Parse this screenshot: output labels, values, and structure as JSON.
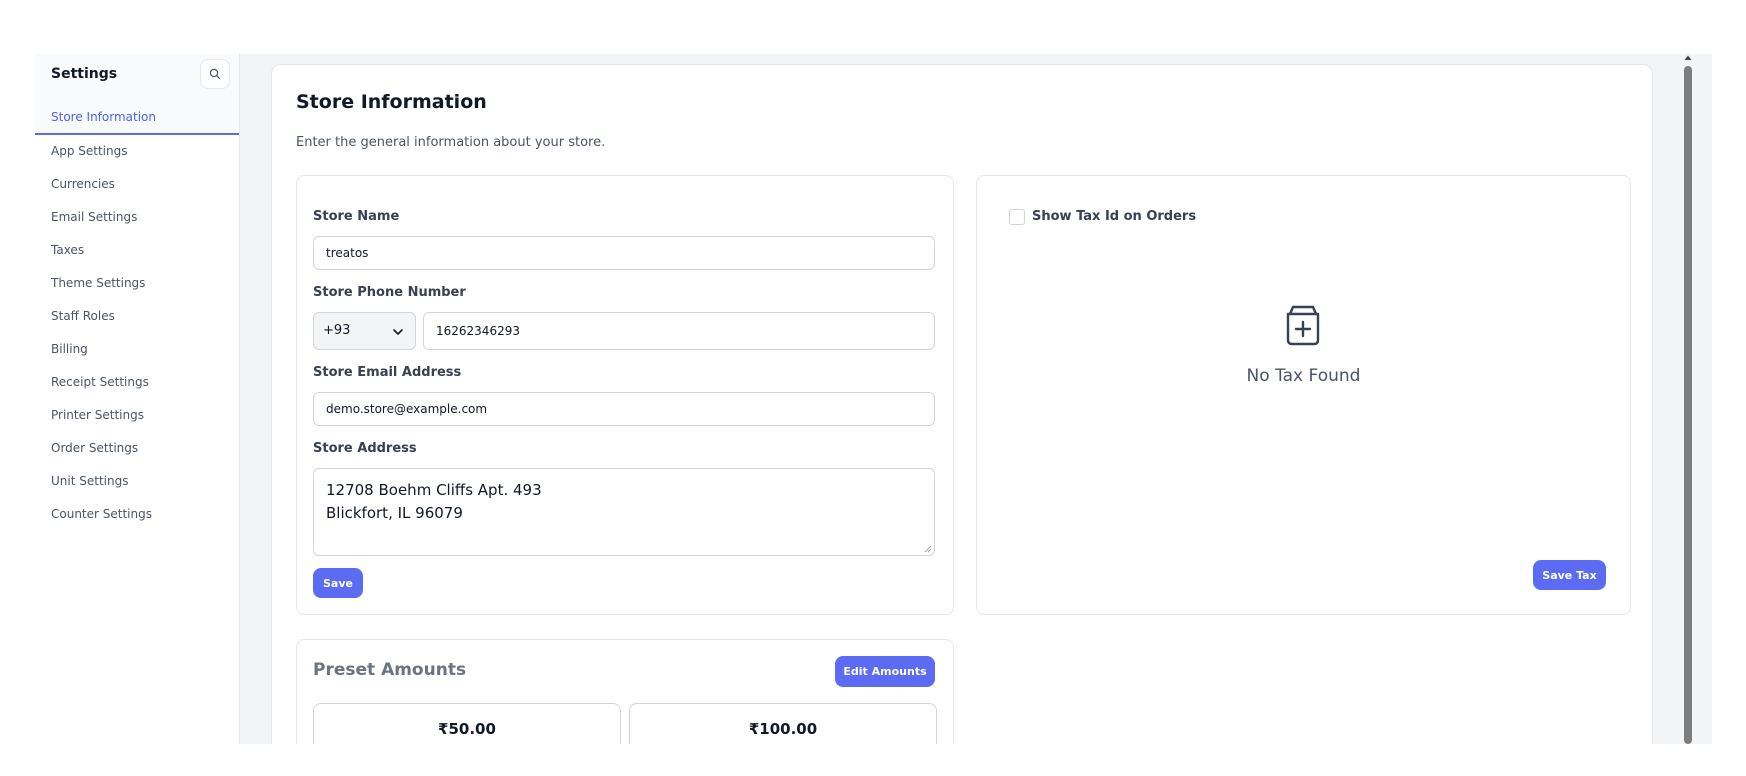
{
  "sidebar": {
    "title": "Settings",
    "search_icon": "search-icon",
    "items": [
      {
        "label": "Store Information",
        "active": true
      },
      {
        "label": "App Settings"
      },
      {
        "label": "Currencies"
      },
      {
        "label": "Email Settings"
      },
      {
        "label": "Taxes"
      },
      {
        "label": "Theme Settings"
      },
      {
        "label": "Staff Roles"
      },
      {
        "label": "Billing"
      },
      {
        "label": "Receipt Settings"
      },
      {
        "label": "Printer Settings"
      },
      {
        "label": "Order Settings"
      },
      {
        "label": "Unit Settings"
      },
      {
        "label": "Counter Settings"
      }
    ]
  },
  "main": {
    "title": "Store Information",
    "subtitle": "Enter the general information about your store."
  },
  "store_form": {
    "name_label": "Store Name",
    "name_value": "treatos",
    "phone_label": "Store Phone Number",
    "phone_code": "+93",
    "phone_value": "16262346293",
    "email_label": "Store Email Address",
    "email_value": "demo.store@example.com",
    "address_label": "Store Address",
    "address_line1": "12708 Boehm Cliffs Apt. 493",
    "address_line2": "Blickfort, IL 96079",
    "save_label": "Save"
  },
  "tax": {
    "show_tax_id_label": "Show Tax Id on Orders",
    "show_tax_id_checked": false,
    "empty_icon": "box-plus-icon",
    "empty_text": "No Tax Found",
    "save_label": "Save Tax"
  },
  "preset": {
    "title": "Preset Amounts",
    "edit_label": "Edit Amounts",
    "amounts": [
      "₹50.00",
      "₹100.00"
    ]
  },
  "colors": {
    "accent": "#5b6cf2",
    "background": "#f3f4f6"
  }
}
